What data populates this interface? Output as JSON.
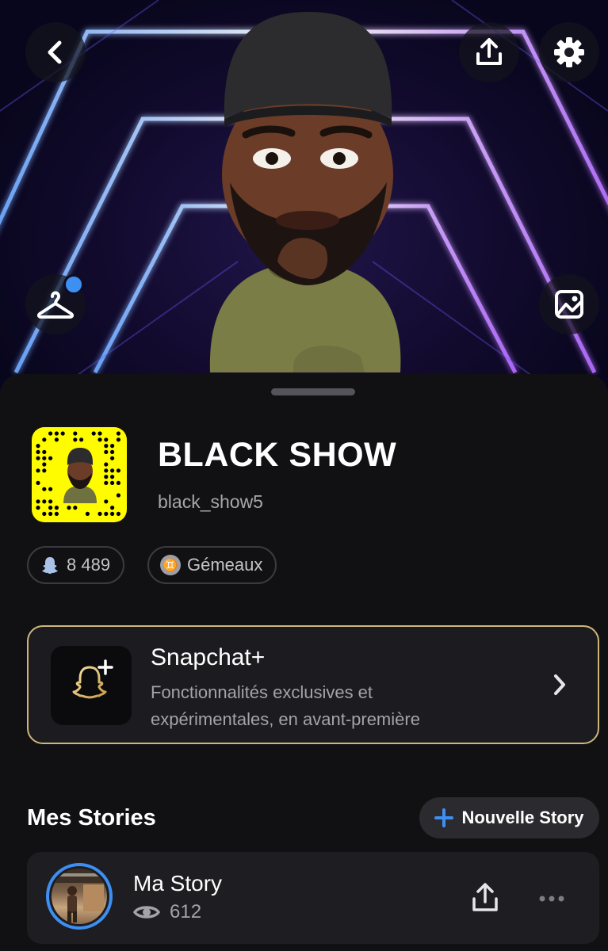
{
  "profile": {
    "display_name": "BLACK SHOW",
    "username": "black_show5",
    "score": "8 489",
    "zodiac": "Gémeaux",
    "zodiac_symbol": "♊"
  },
  "header": {
    "back_icon": "chevron-left-icon",
    "share_icon": "share-upload-icon",
    "settings_icon": "gear-icon",
    "wardrobe_icon": "hanger-icon",
    "background_icon": "image-icon",
    "wardrobe_notification": true
  },
  "snapchat_plus": {
    "title": "Snapchat+",
    "description": "Fonctionnalités exclusives et expérimentales, en avant-première",
    "accent_color": "#cfb77a"
  },
  "stories": {
    "section_title": "Mes Stories",
    "new_story_label": "Nouvelle Story",
    "items": [
      {
        "title": "Ma Story",
        "views": "612"
      }
    ]
  },
  "colors": {
    "accent_blue": "#3d8ff2",
    "snapcode_yellow": "#fffc00",
    "sheet_bg": "#111114"
  }
}
